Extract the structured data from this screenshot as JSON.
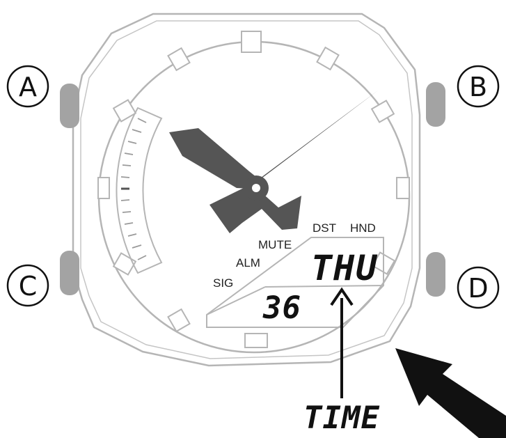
{
  "buttons": {
    "a": "A",
    "b": "B",
    "c": "C",
    "d": "D"
  },
  "indicators": {
    "dst": "DST",
    "hnd": "HND",
    "mute": "MUTE",
    "alm": "ALM",
    "sig": "SIG"
  },
  "lcd": {
    "day": "THU",
    "number": "36"
  },
  "caption": "TIME",
  "colors": {
    "outline": "#b5b5b5",
    "hand": "#555555",
    "button": "#a3a3a3",
    "ink": "#111111"
  }
}
